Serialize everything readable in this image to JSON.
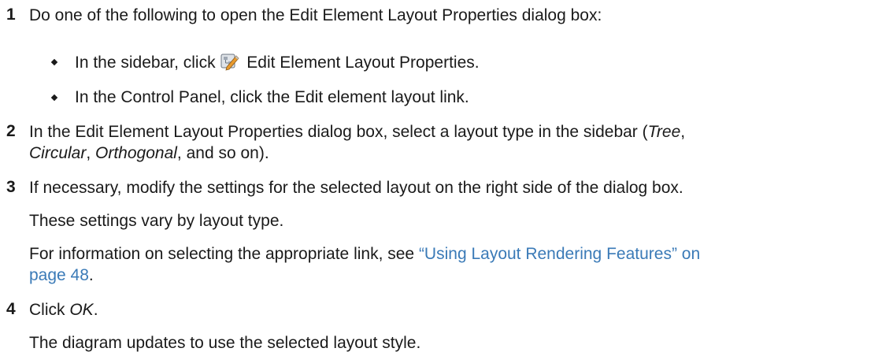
{
  "steps": [
    {
      "number": "1",
      "text": "Do one of the following to open the Edit Element Layout Properties dialog box:",
      "bullets": [
        {
          "pre": "In the sidebar, click ",
          "icon": "edit-layout-properties-icon",
          "post": " Edit Element Layout Properties."
        },
        {
          "text": "In the Control Panel, click the Edit element layout link."
        }
      ]
    },
    {
      "number": "2",
      "line1_pre": "In the Edit Element Layout Properties dialog box, select a layout type in the sidebar (",
      "term_tree": "Tree",
      "sep1": ",",
      "term_circular": "Circular",
      "sep2": ", ",
      "term_orthogonal": "Orthogonal",
      "line2_post": ", and so on)."
    },
    {
      "number": "3",
      "text": "If necessary, modify the settings for the selected layout on the right side of the dialog box.",
      "para1": "These settings vary by layout type.",
      "para2_pre": "For information on selecting the appropriate link, see ",
      "link_line1": "“Using Layout Rendering Features” on",
      "link_line2": "page 48",
      "para2_post": "."
    },
    {
      "number": "4",
      "text_pre": "Click ",
      "text_em": "OK",
      "text_post": ".",
      "para1": "The diagram updates to use the selected layout style."
    }
  ]
}
